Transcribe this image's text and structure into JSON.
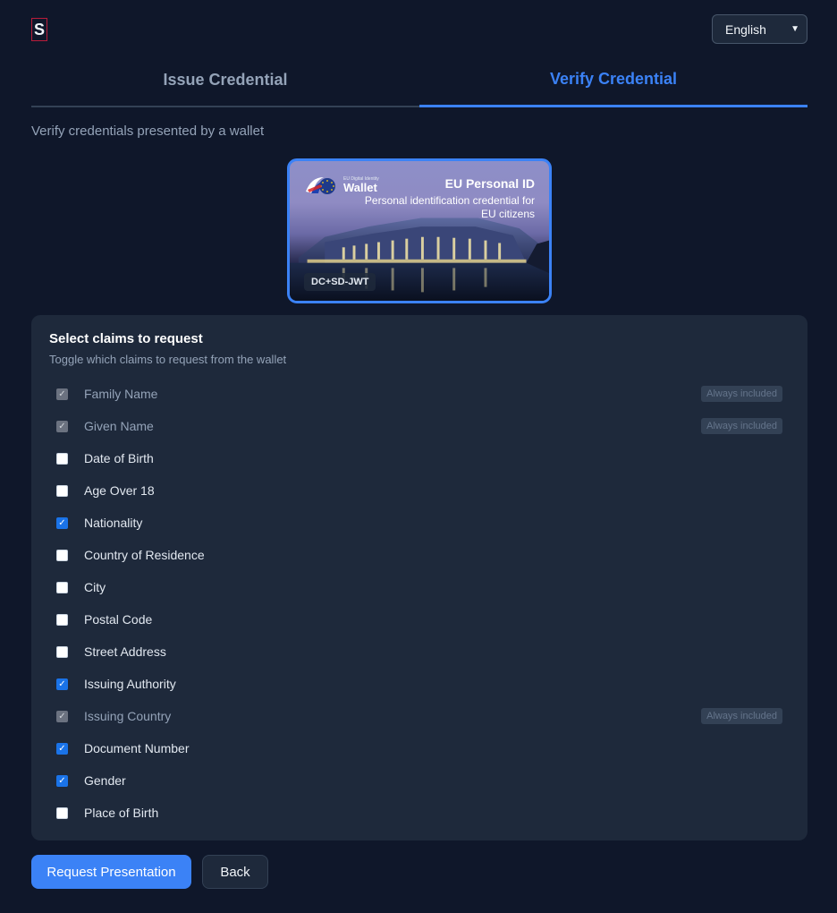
{
  "logo": {
    "letter": "S"
  },
  "language": {
    "selected": "English"
  },
  "tabs": [
    {
      "label": "Issue Credential",
      "active": false
    },
    {
      "label": "Verify Credential",
      "active": true
    }
  ],
  "subtitle": "Verify credentials presented by a wallet",
  "credential_card": {
    "wallet_small": "EU Digital Identity",
    "wallet_big": "Wallet",
    "title": "EU Personal ID",
    "description": "Personal identification credential for EU citizens",
    "format": "DC+SD-JWT"
  },
  "claims_panel": {
    "title": "Select claims to request",
    "hint": "Toggle which claims to request from the wallet",
    "always_label": "Always included",
    "claims": [
      {
        "label": "Family Name",
        "checked": true,
        "always": true
      },
      {
        "label": "Given Name",
        "checked": true,
        "always": true
      },
      {
        "label": "Date of Birth",
        "checked": false,
        "always": false
      },
      {
        "label": "Age Over 18",
        "checked": false,
        "always": false
      },
      {
        "label": "Nationality",
        "checked": true,
        "always": false
      },
      {
        "label": "Country of Residence",
        "checked": false,
        "always": false
      },
      {
        "label": "City",
        "checked": false,
        "always": false
      },
      {
        "label": "Postal Code",
        "checked": false,
        "always": false
      },
      {
        "label": "Street Address",
        "checked": false,
        "always": false
      },
      {
        "label": "Issuing Authority",
        "checked": true,
        "always": false
      },
      {
        "label": "Issuing Country",
        "checked": true,
        "always": true
      },
      {
        "label": "Document Number",
        "checked": true,
        "always": false
      },
      {
        "label": "Gender",
        "checked": true,
        "always": false
      },
      {
        "label": "Place of Birth",
        "checked": false,
        "always": false
      }
    ]
  },
  "actions": {
    "primary": "Request Presentation",
    "secondary": "Back"
  },
  "colors": {
    "background": "#0f172a",
    "panel": "#1e293b",
    "accent": "#3b82f6",
    "checkbox_checked": "#1a73e8"
  }
}
